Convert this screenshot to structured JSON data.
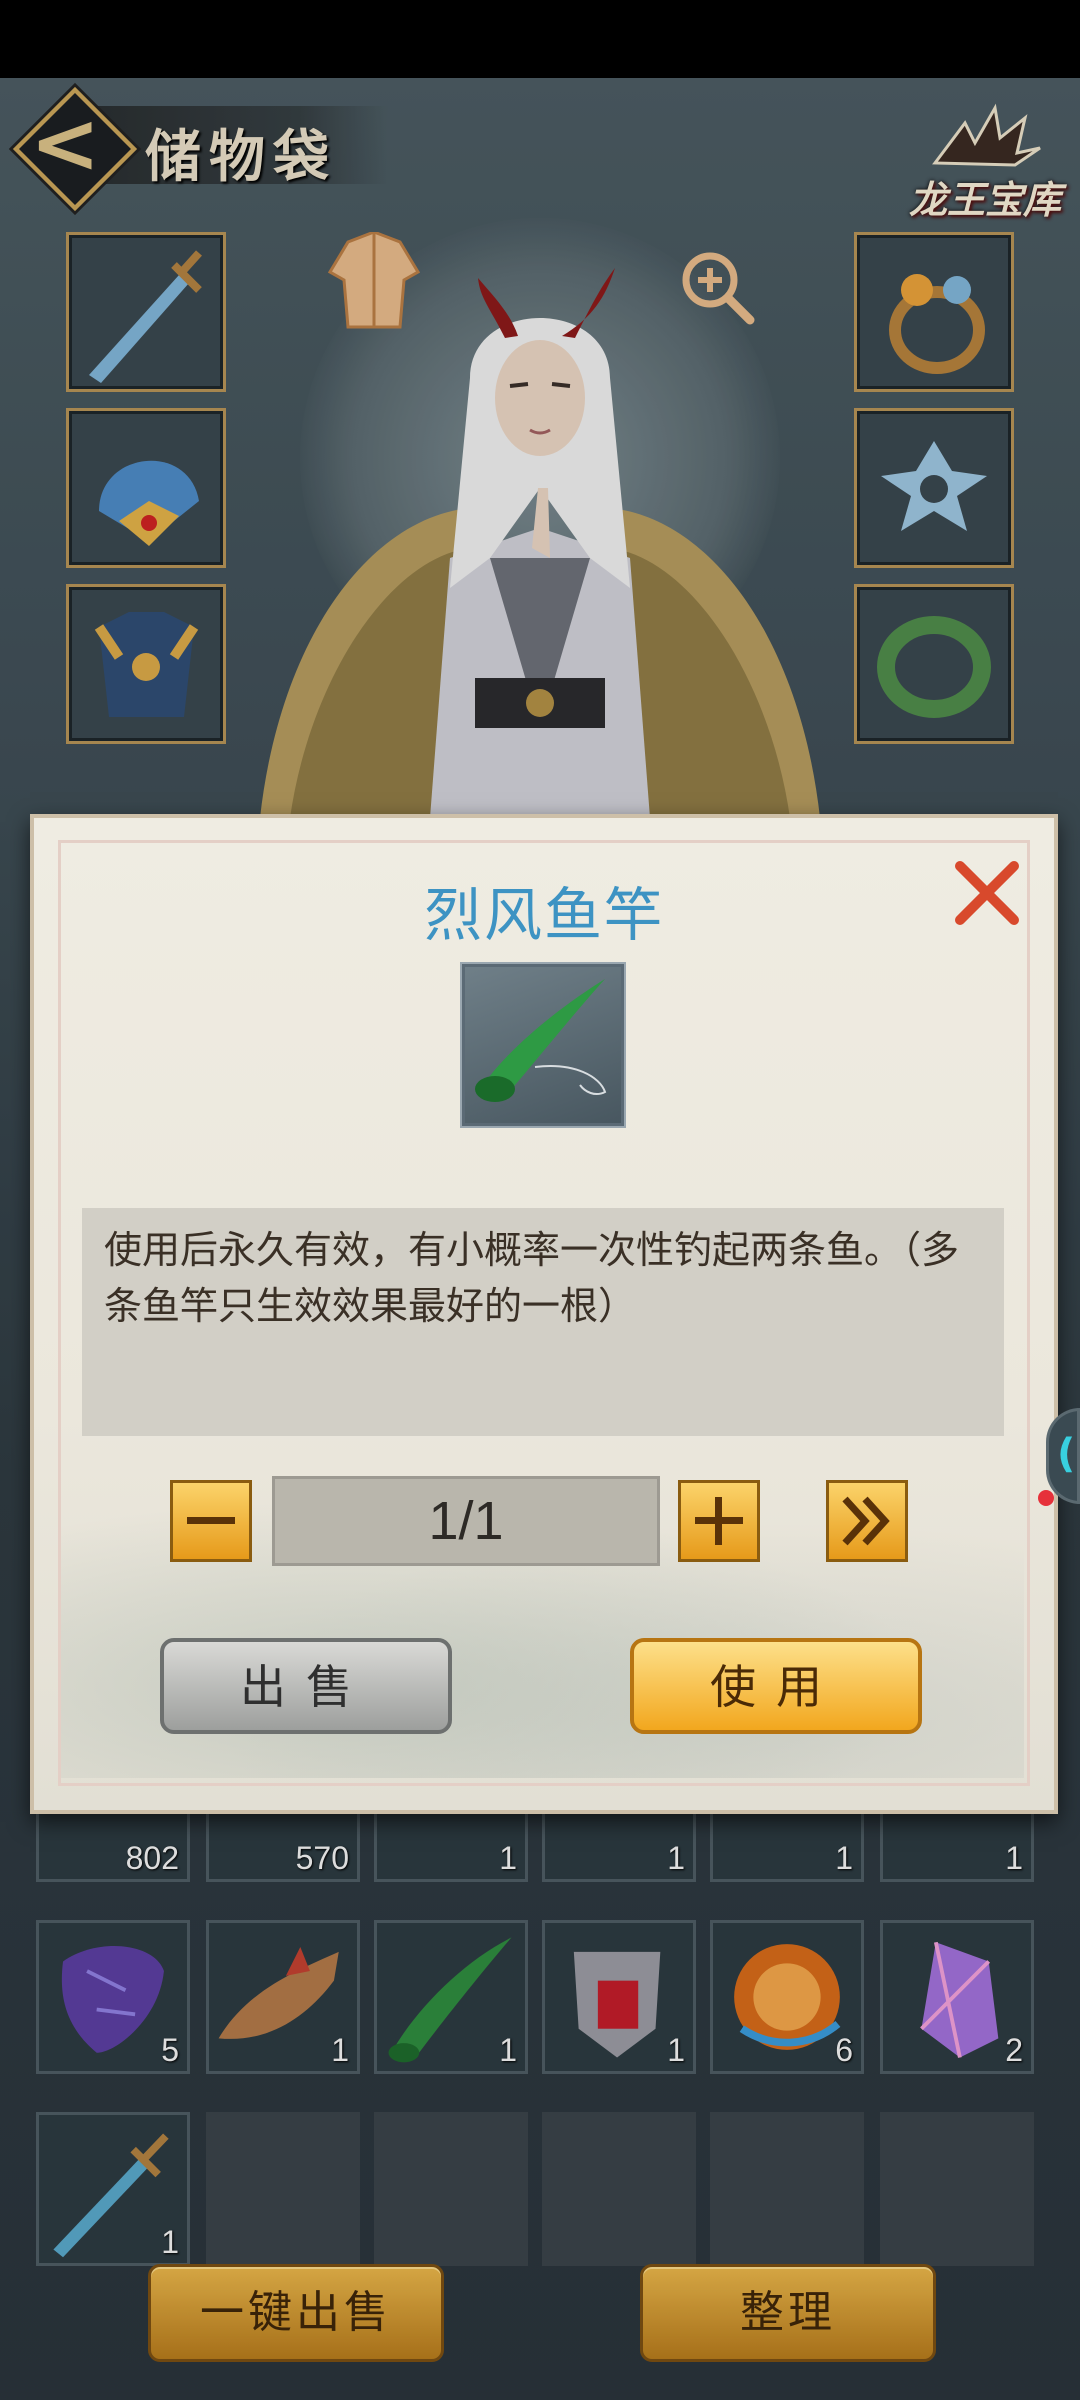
{
  "header": {
    "title": "储物袋",
    "logo_text": "龙王宝库"
  },
  "dialog": {
    "item_name": "烈风鱼竿",
    "description": "使用后永久有效，有小概率一次性钓起两条鱼。（多条鱼竿只生效效果最好的一根）",
    "quantity": "1/1",
    "sell_label": "出售",
    "use_label": "使用",
    "title_color": "#3d93c3"
  },
  "bag": {
    "row1_counts": [
      "802",
      "570",
      "1",
      "1",
      "1",
      "1"
    ],
    "row2_counts": [
      "5",
      "1",
      "1",
      "1",
      "6",
      "2"
    ],
    "row3_counts": [
      "1"
    ]
  },
  "bottom": {
    "sell_all_label": "一键出售",
    "sort_label": "整理"
  },
  "icons": {
    "back": "back-arrow-icon",
    "close": "close-icon",
    "minus": "minus-icon",
    "plus": "plus-icon",
    "max": "double-chevron-icon"
  }
}
